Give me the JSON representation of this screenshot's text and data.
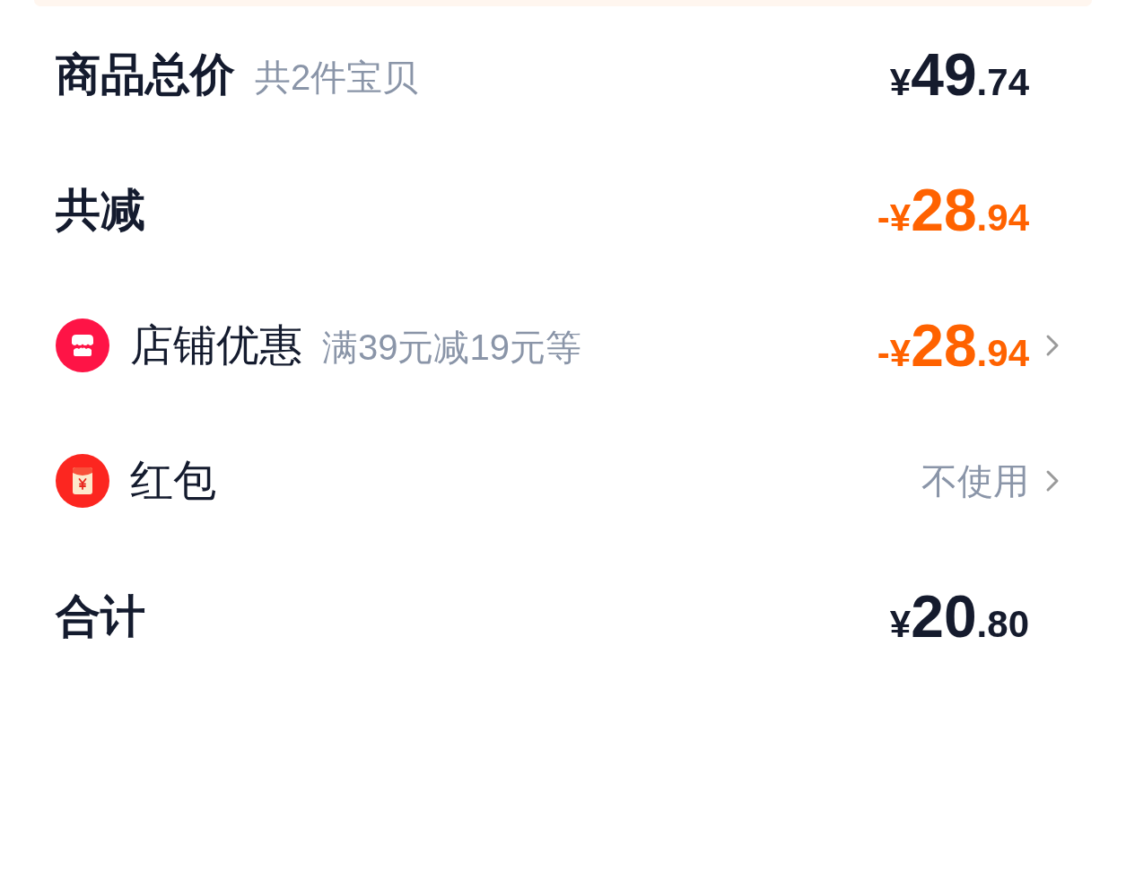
{
  "rows": [
    {
      "kind": "summary",
      "label": "商品总价",
      "note": "共2件宝贝",
      "price": {
        "prefix": "¥",
        "integer": "49",
        "decimal": ".74",
        "discount": false
      }
    },
    {
      "kind": "summary",
      "label": "共减",
      "price": {
        "prefix": "-¥",
        "integer": "28",
        "decimal": ".94",
        "discount": true
      }
    },
    {
      "kind": "store",
      "label": "店铺优惠",
      "note": "满39元减19元等",
      "price": {
        "prefix": "-¥",
        "integer": "28",
        "decimal": ".94",
        "discount": true
      }
    },
    {
      "kind": "packet",
      "label": "红包",
      "value": "不使用"
    },
    {
      "kind": "summary",
      "label": "合计",
      "price": {
        "prefix": "¥",
        "integer": "20",
        "decimal": ".80",
        "discount": false
      }
    }
  ]
}
